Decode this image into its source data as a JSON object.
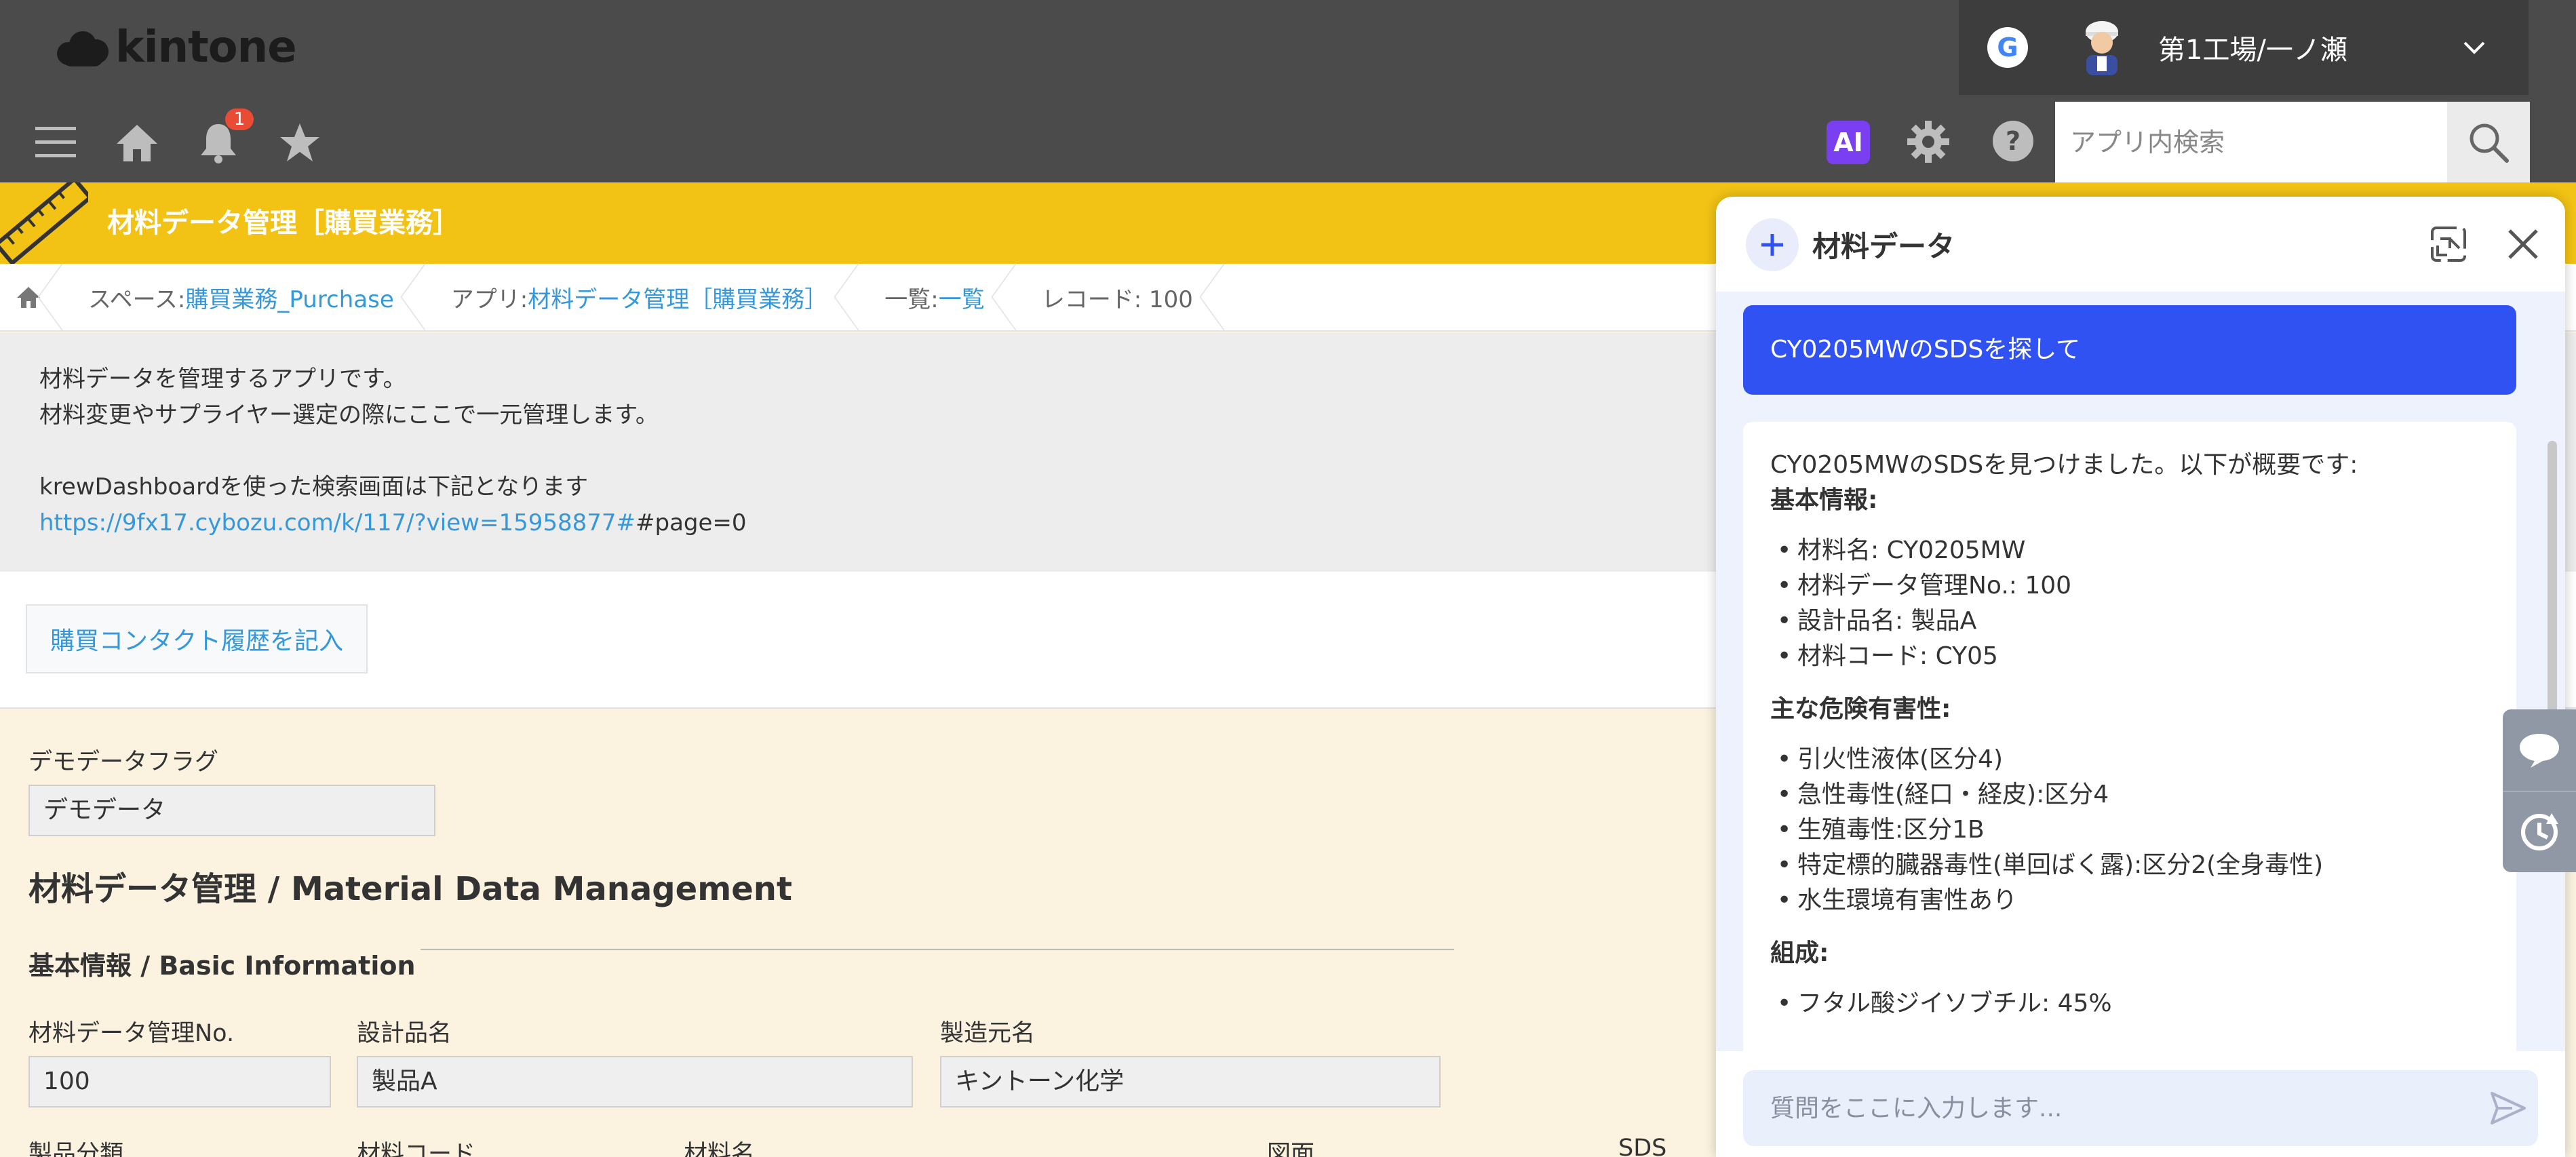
{
  "header": {
    "logo_text": "kintone",
    "google_letter": "G",
    "user_name": "第1工場/一ノ瀬",
    "notification_count": "1",
    "ai_label": "AI",
    "search_placeholder": "アプリ内検索"
  },
  "app_bar": {
    "title": "材料データ管理［購買業務］"
  },
  "breadcrumb": {
    "space_prefix": "スペース: ",
    "space_name": "購買業務_Purchase",
    "app_prefix": "アプリ: ",
    "app_name": "材料データ管理［購買業務］",
    "view_prefix": "一覧: ",
    "view_name": "一覧",
    "record_label": "レコード: 100"
  },
  "description": {
    "line1": "材料データを管理するアプリです。",
    "line2": "材料変更やサプライヤー選定の際にここで一元管理します。",
    "line3": "krewDashboardを使った検索画面は下記となります",
    "link": "https://9fx17.cybozu.com/k/117/?view=15958877#",
    "link_suffix": "#page=0"
  },
  "actions": {
    "contact_button": "購買コンタクト履歴を記入"
  },
  "form": {
    "demo_flag_label": "デモデータフラグ",
    "demo_flag_value": "デモデータ",
    "section_title": "材料データ管理 / Material Data Management",
    "subsection_title": "基本情報 / Basic Information",
    "mgmt_no_label": "材料データ管理No.",
    "mgmt_no_value": "100",
    "design_name_label": "設計品名",
    "design_name_value": "製品A",
    "maker_label": "製造元名",
    "maker_value": "キントーン化学",
    "product_class_label": "製品分類",
    "material_code_label": "材料コード",
    "material_name_label": "材料名",
    "drawing_label": "図面",
    "sds_label": "SDS"
  },
  "chat": {
    "title": "材料データ",
    "user_message": "CY0205MWのSDSを探して",
    "intro": "CY0205MWのSDSを見つけました。以下が概要です:",
    "basic_heading": "基本情報:",
    "basic_items": [
      "材料名: CY0205MW",
      "材料データ管理No.: 100",
      "設計品名: 製品A",
      "材料コード: CY05"
    ],
    "hazard_heading": "主な危険有害性:",
    "hazard_items": [
      "引火性液体(区分4)",
      "急性毒性(経口・経皮):区分4",
      "生殖毒性:区分1B",
      "特定標的臓器毒性(単回ばく露):区分2(全身毒性)",
      "水生環境有害性あり"
    ],
    "composition_heading": "組成:",
    "composition_items": [
      "フタル酸ジイソブチル: 45%"
    ],
    "input_placeholder": "質問をここに入力します..."
  },
  "colors": {
    "header_bg": "#4b4b4b",
    "app_bar": "#f2c314",
    "link": "#3498db",
    "user_bubble": "#3152f2",
    "ai_badge": "#7b3ff2"
  }
}
